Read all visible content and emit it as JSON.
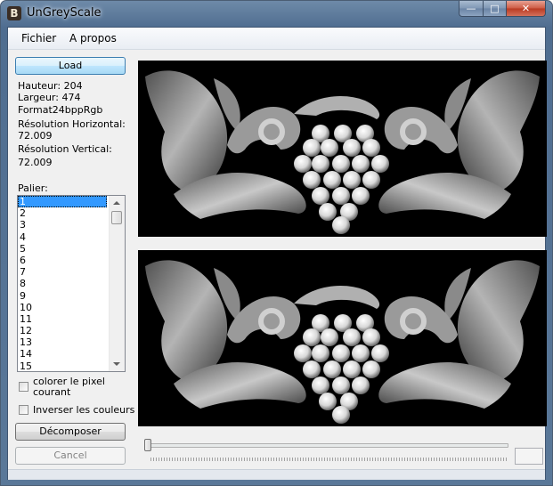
{
  "window": {
    "title": "UnGreyScale",
    "icon_letter": "B",
    "minimize": "—",
    "maximize": "□",
    "close": "✕"
  },
  "menu": {
    "items": [
      "Fichier",
      "A propos"
    ]
  },
  "buttons": {
    "load": "Load",
    "decompose": "Décomposer",
    "cancel": "Cancel"
  },
  "info": {
    "hauteur": "Hauteur: 204",
    "largeur": "Largeur: 474",
    "format": "Format24bppRgb",
    "res_h_label": "Résolution Horizontal:",
    "res_h_value": "72.009",
    "res_v_label": "Résolution Vertical:",
    "res_v_value": "72.009"
  },
  "palier": {
    "label": "Palier:",
    "items": [
      "1",
      "2",
      "3",
      "4",
      "5",
      "6",
      "7",
      "8",
      "9",
      "10",
      "11",
      "12",
      "13",
      "14",
      "15"
    ],
    "selected": "1"
  },
  "checkboxes": {
    "colorer_line1": "colorer le pixel",
    "colorer_line2": "courant",
    "colorer_checked": false,
    "inverser": "Inverser les couleurs",
    "inverser_checked": false
  },
  "slider": {
    "value_fraction": 0.0
  },
  "colors": {
    "image_bg": "#000000",
    "selection": "#3399ff",
    "titlebar": "#5f7ea1"
  }
}
